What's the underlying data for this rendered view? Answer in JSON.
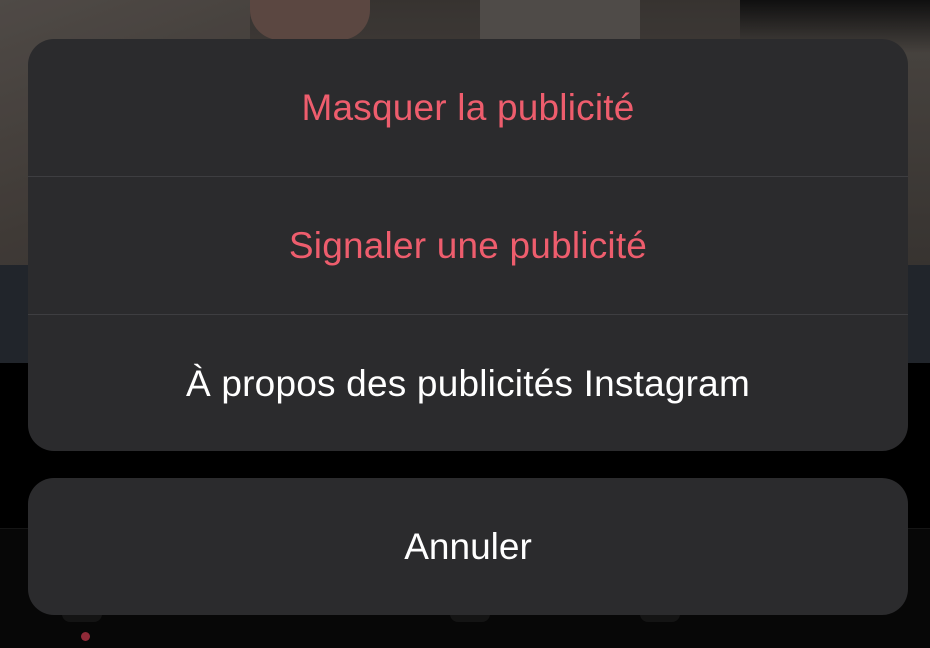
{
  "action_sheet": {
    "items": [
      {
        "label": "Masquer la publicité",
        "style": "destructive"
      },
      {
        "label": "Signaler une publicité",
        "style": "destructive"
      },
      {
        "label": "À propos des publicités Instagram",
        "style": "default"
      }
    ],
    "cancel_label": "Annuler"
  },
  "colors": {
    "destructive": "#ee5d6d",
    "default_text": "#ffffff",
    "sheet_background": "#2b2b2d"
  }
}
